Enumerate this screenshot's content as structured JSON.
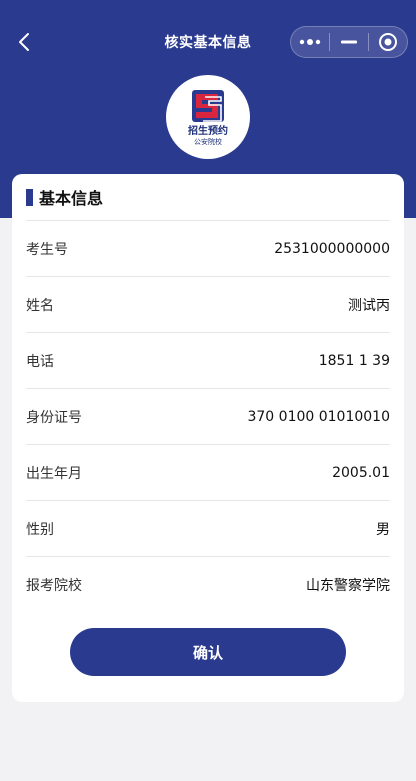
{
  "nav": {
    "title": "核实基本信息",
    "back_icon": "chevron-left-icon",
    "more_icon": "more-dots-icon",
    "minimize_icon": "minus-icon",
    "close_icon": "target-circle-icon"
  },
  "logo": {
    "line1": "招生预约",
    "line2": "公安院校",
    "colors": {
      "primary": "#2a3a8f",
      "accent": "#d7263d"
    }
  },
  "card": {
    "section_title": "基本信息",
    "rows": [
      {
        "label": "考生号",
        "value": "2531000000000"
      },
      {
        "label": "姓名",
        "value": "测试丙"
      },
      {
        "label": "电话",
        "value": "1851 1  39"
      },
      {
        "label": "身份证号",
        "value": "370 0100 01010010"
      },
      {
        "label": "出生年月",
        "value": "2005.01"
      },
      {
        "label": "性别",
        "value": "男"
      },
      {
        "label": "报考院校",
        "value": "山东警察学院"
      }
    ],
    "confirm_label": "确认"
  },
  "theme": {
    "primary": "#2a3a8f",
    "background": "#f2f2f4"
  }
}
